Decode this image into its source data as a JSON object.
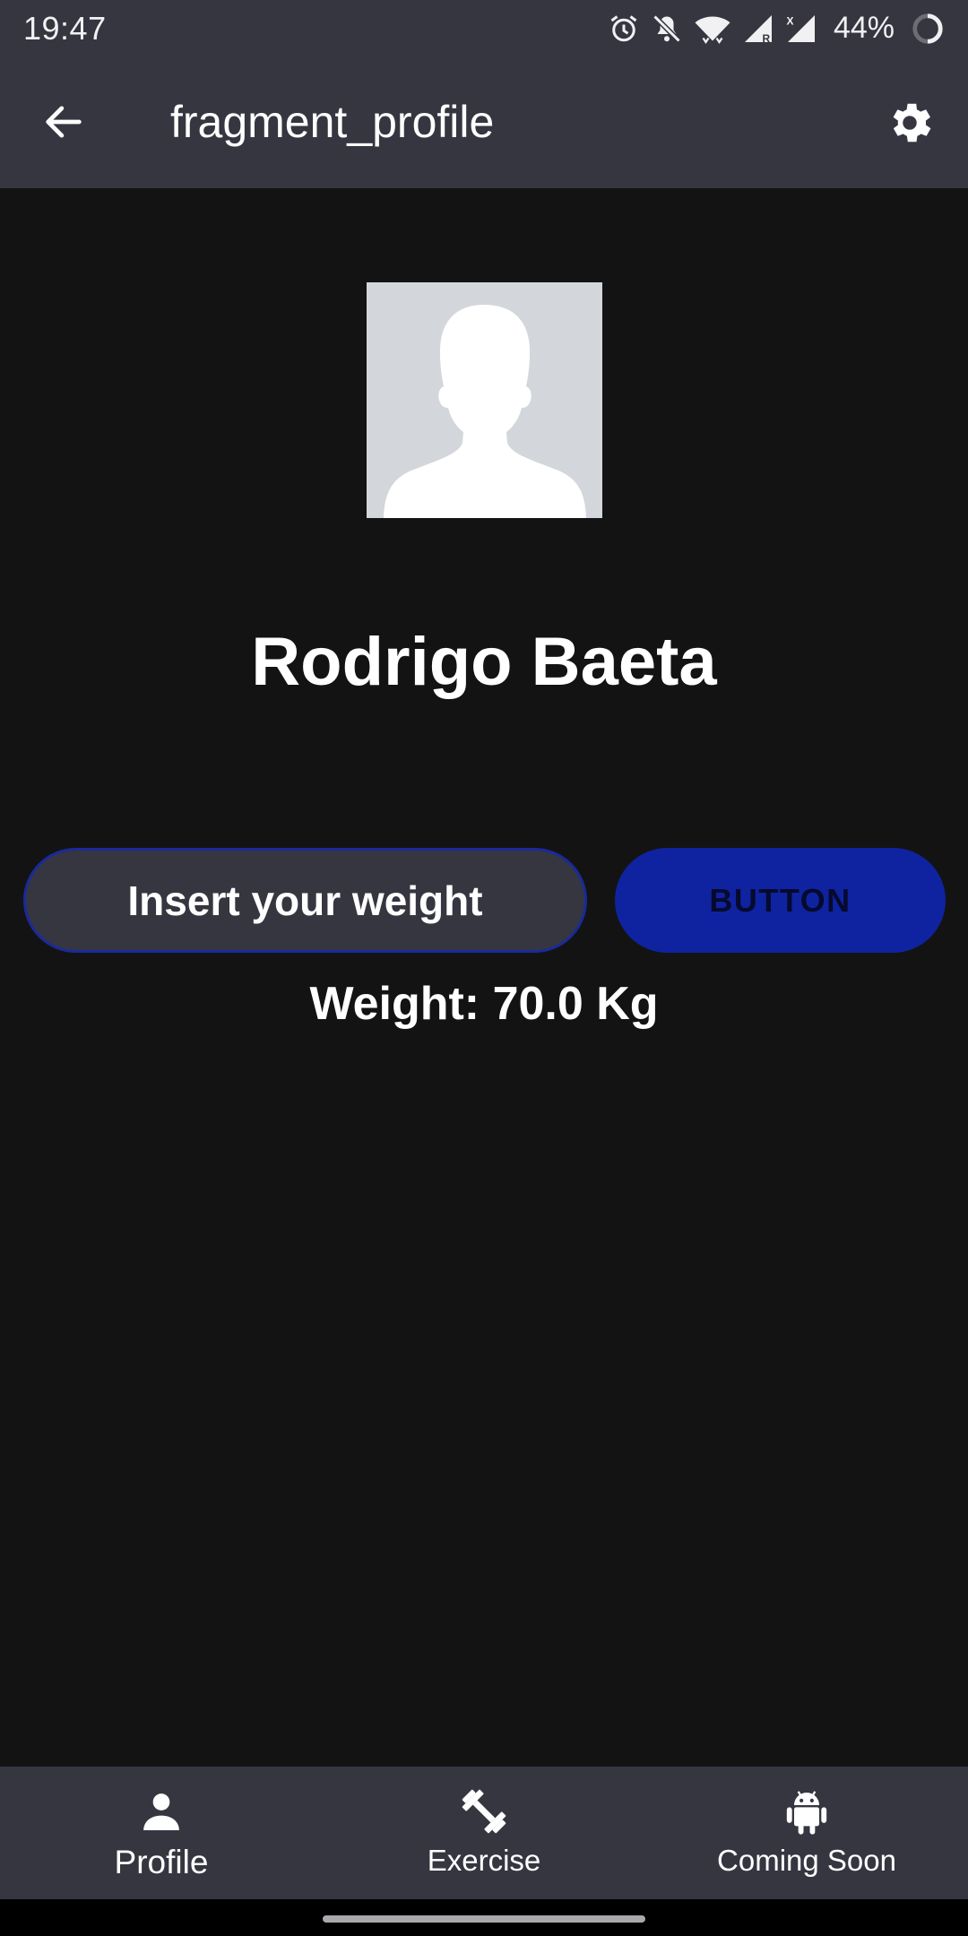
{
  "status_bar": {
    "time": "19:47",
    "battery": "44%",
    "icons": [
      "alarm-icon",
      "bell-off-icon",
      "wifi-icon",
      "signal-roaming-icon",
      "signal-x-icon",
      "battery-ring-icon"
    ]
  },
  "app_bar": {
    "title": "fragment_profile",
    "back_icon": "arrow-left-icon",
    "settings_icon": "gear-icon"
  },
  "profile": {
    "name": "Rodrigo Baeta",
    "avatar_icon": "person-silhouette-placeholder"
  },
  "weight_form": {
    "input_label": "Insert your weight",
    "button_label": "BUTTON",
    "readout": "Weight: 70.0 Kg"
  },
  "bottom_nav": {
    "items": [
      {
        "label": "Profile",
        "icon": "person-icon",
        "active": true
      },
      {
        "label": "Exercise",
        "icon": "dumbbell-icon",
        "active": false
      },
      {
        "label": "Coming Soon",
        "icon": "android-icon",
        "active": false
      }
    ]
  },
  "colors": {
    "bars": "#363641",
    "background": "#131314",
    "accent": "#0f23a0",
    "avatar_bg": "#d3d6da"
  }
}
